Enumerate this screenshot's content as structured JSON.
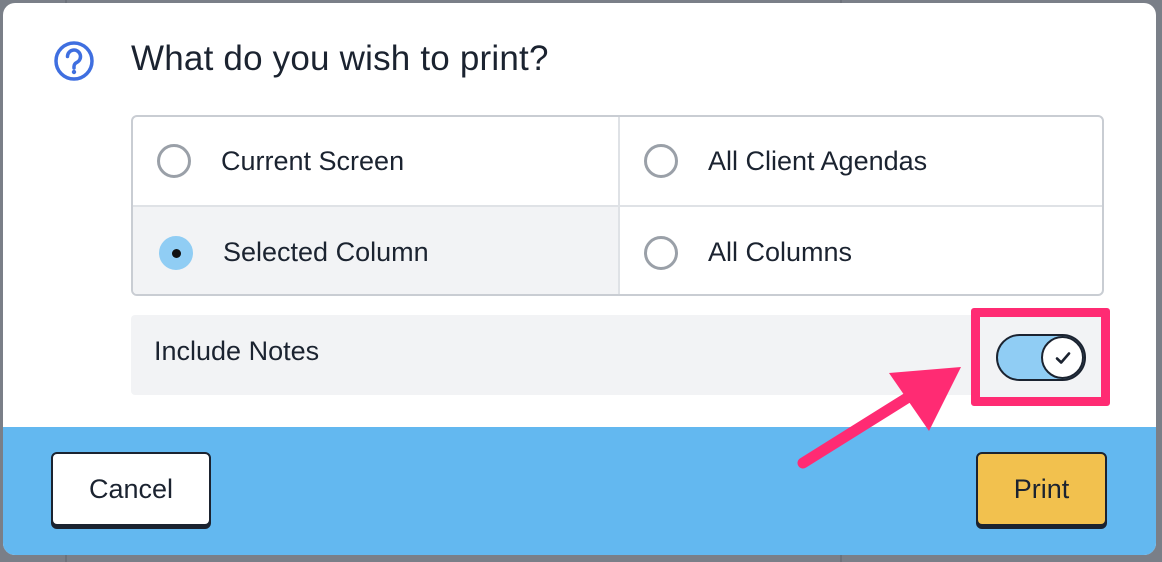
{
  "dialog": {
    "title": "What do you wish to print?",
    "icon": "question-circle-icon",
    "accent_color": "#3f6fe0"
  },
  "options": [
    {
      "label": "Current Screen",
      "selected": false
    },
    {
      "label": "All Client Agendas",
      "selected": false
    },
    {
      "label": "Selected Column",
      "selected": true
    },
    {
      "label": "All Columns",
      "selected": false
    }
  ],
  "include_notes": {
    "label": "Include Notes",
    "enabled": true,
    "icon": "checkmark-icon"
  },
  "annotation": {
    "highlight_color": "#ff2b73",
    "arrow_icon": "pointer-arrow-icon"
  },
  "footer": {
    "cancel_label": "Cancel",
    "print_label": "Print",
    "background_color": "#63b8f0",
    "print_color": "#f2c14e"
  }
}
